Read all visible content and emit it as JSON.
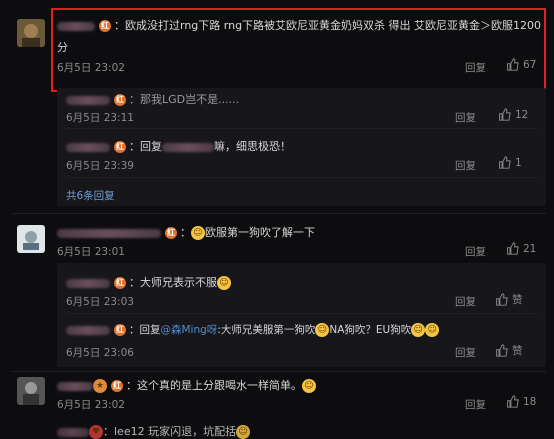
{
  "comments": [
    {
      "text_line1": "：欧成没打过rng下路 rng下路被艾欧尼亚黄金奶妈双杀 得出 艾欧尼亚黄金＞欧服1200",
      "text_line2": "分",
      "time": "6月5日 23:02",
      "reply_label": "回复",
      "likes": "67",
      "replies": [
        {
          "text": "：那我LGD岂不是......",
          "time": "6月5日 23:11",
          "reply_label": "回复",
          "likes": "12"
        },
        {
          "prefix": "：回复",
          "suffix": "嘛，细思极恐！",
          "time": "6月5日 23:39",
          "reply_label": "回复",
          "likes": "1"
        }
      ],
      "more_replies": "共6条回复"
    },
    {
      "text": "欧服第一狗吹了解一下",
      "time": "6月5日 23:01",
      "reply_label": "回复",
      "likes": "21",
      "replies": [
        {
          "text": "：大师兄表示不服",
          "time": "6月5日 23:03",
          "reply_label": "回复",
          "likes": "赞"
        },
        {
          "prefix": "：回复",
          "mention": "@森Ming呀",
          "text": ":大师兄美服第一狗吹",
          "mid": "NA狗吹？EU狗吹",
          "time": "6月5日 23:06",
          "reply_label": "回复",
          "likes": "赞"
        }
      ]
    },
    {
      "text": "：这个真的是上分跟喝水一样简单。",
      "time": "6月5日 23:02",
      "reply_label": "回复",
      "likes": "18"
    },
    {
      "partial_text": "：lee12 玩家闪退，坑配括"
    }
  ],
  "colors": {
    "highlight": "#e01f1f",
    "badge": "#e0722a",
    "mention": "#4c8fd6"
  }
}
